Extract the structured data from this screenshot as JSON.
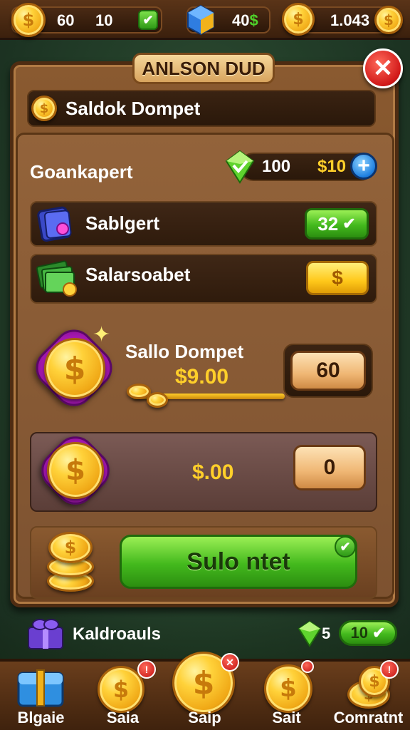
{
  "top_bar": {
    "coins_value": "60",
    "count_value": "10",
    "gems_value": "40",
    "gems_suffix": "$",
    "balance_value": "1.043"
  },
  "dialog": {
    "title": "ANLSON DUD",
    "wallet_label": "Saldok Dompet",
    "section_label": "Goankapert",
    "section_value": "100",
    "section_price": "$10",
    "section_add": "+"
  },
  "rows": [
    {
      "label": "Sablgert",
      "button_value": "32",
      "button_color": "#43b91d"
    },
    {
      "label": "Salarsoabet",
      "button_value": "$",
      "button_color": "#ffc81a"
    }
  ],
  "balance_card": {
    "title": "Sallo Dompet",
    "amount": "$9.00",
    "button_value": "60"
  },
  "second_card": {
    "amount": "$.00",
    "button_value": "0"
  },
  "main_action": {
    "label": "Sulo ntet"
  },
  "footer": {
    "item_label": "Kaldroauls",
    "gem_count": "5",
    "pill_value": "10"
  },
  "nav": [
    {
      "label": "Blgaie",
      "icon": "chest-icon"
    },
    {
      "label": "Saia",
      "icon": "coin-icon"
    },
    {
      "label": "Saip",
      "icon": "coin-icon"
    },
    {
      "label": "Sait",
      "icon": "coin-icon"
    },
    {
      "label": "Comratnt",
      "icon": "coin-stack-icon"
    }
  ],
  "colors": {
    "wood": "#7d5230",
    "accent_green": "#43b91d",
    "accent_yellow": "#ffc81a",
    "gold_text": "#ffcf2a",
    "gem_purple": "#c21fc9",
    "close_red": "#d11818"
  }
}
